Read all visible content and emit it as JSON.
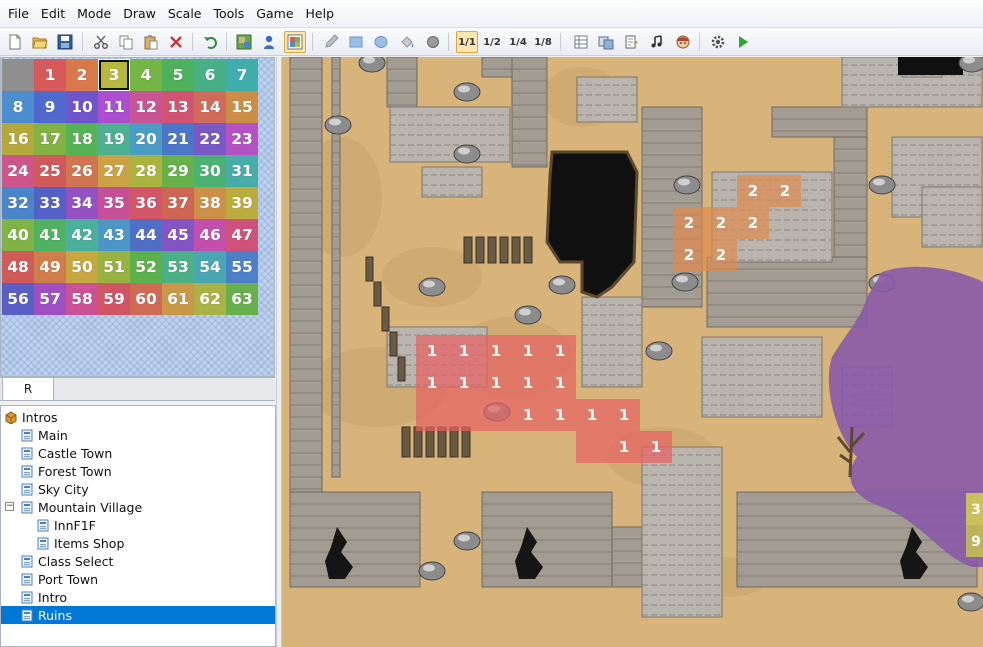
{
  "menu": [
    "File",
    "Edit",
    "Mode",
    "Draw",
    "Scale",
    "Tools",
    "Game",
    "Help"
  ],
  "toolbar": {
    "buttons": [
      {
        "name": "new-project",
        "icon": "new-file-icon"
      },
      {
        "name": "open-project",
        "icon": "folder-open-icon"
      },
      {
        "name": "save-project",
        "icon": "save-icon"
      },
      {
        "name": "cut",
        "icon": "scissors-icon"
      },
      {
        "name": "copy",
        "icon": "copy-icon"
      },
      {
        "name": "paste",
        "icon": "paste-icon"
      },
      {
        "name": "delete",
        "icon": "delete-x-icon"
      },
      {
        "name": "undo",
        "icon": "undo-icon"
      },
      {
        "name": "map-layer",
        "icon": "map-layer-icon"
      },
      {
        "name": "event-layer",
        "icon": "event-layer-icon"
      },
      {
        "name": "region-layer",
        "icon": "region-layer-icon"
      },
      {
        "name": "pencil",
        "icon": "pencil-icon"
      },
      {
        "name": "rectangle",
        "icon": "rectangle-icon"
      },
      {
        "name": "ellipse",
        "icon": "ellipse-icon"
      },
      {
        "name": "flood-fill",
        "icon": "flood-fill-icon"
      },
      {
        "name": "shadow-pen",
        "icon": "shadow-pen-icon"
      },
      {
        "name": "scale-1-1",
        "label": "1/1"
      },
      {
        "name": "scale-1-2",
        "label": "1/2"
      },
      {
        "name": "scale-1-4",
        "label": "1/4"
      },
      {
        "name": "scale-1-8",
        "label": "1/8"
      },
      {
        "name": "database",
        "icon": "database-icon"
      },
      {
        "name": "resource-manager",
        "icon": "resource-manager-icon"
      },
      {
        "name": "script-editor",
        "icon": "script-editor-icon"
      },
      {
        "name": "sound-test",
        "icon": "music-note-icon"
      },
      {
        "name": "character-generator",
        "icon": "character-face-icon"
      },
      {
        "name": "options",
        "icon": "gear-icon"
      },
      {
        "name": "playtest",
        "icon": "play-icon"
      }
    ],
    "active_scale": "1/1",
    "active_layer": "region-layer"
  },
  "palette": {
    "tab_label": "R",
    "selected_id": 3,
    "cells": [
      "",
      "1",
      "2",
      "3",
      "4",
      "5",
      "6",
      "7",
      "8",
      "9",
      "10",
      "11",
      "12",
      "13",
      "14",
      "15",
      "16",
      "17",
      "18",
      "19",
      "20",
      "21",
      "22",
      "23",
      "24",
      "25",
      "26",
      "27",
      "28",
      "29",
      "30",
      "31",
      "32",
      "33",
      "34",
      "35",
      "36",
      "37",
      "38",
      "39",
      "40",
      "41",
      "42",
      "43",
      "44",
      "45",
      "46",
      "47",
      "48",
      "49",
      "50",
      "51",
      "52",
      "53",
      "54",
      "55",
      "56",
      "57",
      "58",
      "59",
      "60",
      "61",
      "62",
      "63"
    ],
    "colors": [
      "#8f8f8f",
      "#d8595b",
      "#d9794b",
      "#b8b840",
      "#75b545",
      "#4db05a",
      "#47b087",
      "#40aeac",
      "#4d8ed1",
      "#4f69cf",
      "#6f55cc",
      "#ac4ecf",
      "#c75596",
      "#d25272",
      "#d06a5a",
      "#cc8e46",
      "#b4a83a",
      "#81b242",
      "#55b255",
      "#4db090",
      "#4a9cc4",
      "#4c76c8",
      "#7a58c5",
      "#b451c3",
      "#ce548c",
      "#d05a5a",
      "#cf7550",
      "#cca044",
      "#a9b43e",
      "#67b14b",
      "#4cb174",
      "#48aca9",
      "#4a84c9",
      "#5460c6",
      "#9351c3",
      "#c65098",
      "#d35668",
      "#cf6553",
      "#ce8f48",
      "#bcab3d",
      "#7fb345",
      "#50b163",
      "#4aaf9b",
      "#4a97c6",
      "#4f6ec6",
      "#8454c4",
      "#c24fae",
      "#cf527a",
      "#cf5a58",
      "#ce7d4b",
      "#c6a742",
      "#98b342",
      "#5cb14d",
      "#4bb085",
      "#49a6b3",
      "#4d80c9",
      "#5a5fc6",
      "#a04fc2",
      "#cb5196",
      "#d15565",
      "#cf6b55",
      "#c99748",
      "#a9b244",
      "#68b04c"
    ]
  },
  "tree": [
    {
      "label": "Intros",
      "level": 0,
      "icon": "folder-project-icon"
    },
    {
      "label": "Main",
      "level": 1,
      "icon": "map-file-icon"
    },
    {
      "label": "Castle Town",
      "level": 1,
      "icon": "map-file-icon"
    },
    {
      "label": "Forest Town",
      "level": 1,
      "icon": "map-file-icon"
    },
    {
      "label": "Sky City",
      "level": 1,
      "icon": "map-file-icon"
    },
    {
      "label": "Mountain Village",
      "level": 1,
      "icon": "map-file-icon",
      "expanded": true
    },
    {
      "label": "InnF1F",
      "level": 2,
      "icon": "map-file-icon"
    },
    {
      "label": "Items Shop",
      "level": 2,
      "icon": "map-file-icon"
    },
    {
      "label": "Class Select",
      "level": 1,
      "icon": "map-file-icon"
    },
    {
      "label": "Port Town",
      "level": 1,
      "icon": "map-file-icon"
    },
    {
      "label": "Intro",
      "level": 1,
      "icon": "map-file-icon"
    },
    {
      "label": "Ruins",
      "level": 1,
      "icon": "map-file-icon",
      "selected": true
    }
  ],
  "map": {
    "region_labels": [
      {
        "region": "1",
        "count": 20
      },
      {
        "region": "2",
        "count": 7
      },
      {
        "region": "3",
        "count": 1
      },
      {
        "region": "9",
        "count": 1
      }
    ],
    "colors": {
      "sand": "#d8b47a",
      "stone": "#a39c92",
      "region1": "#e66262",
      "region2": "#e08a4e",
      "poison": "#8a5aa8",
      "pit": "#101010"
    }
  }
}
